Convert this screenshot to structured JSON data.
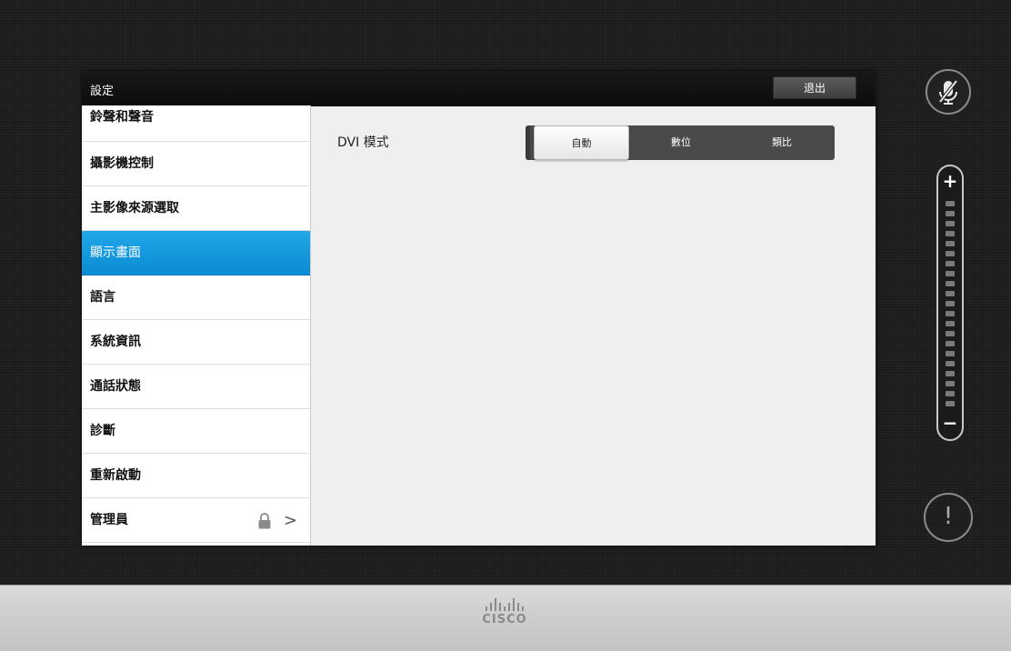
{
  "app": {
    "title": "設定",
    "exit_label": "退出"
  },
  "sidebar": {
    "items": [
      {
        "label": "鈴聲和聲音"
      },
      {
        "label": "攝影機控制"
      },
      {
        "label": "主影像來源選取"
      },
      {
        "label": "顯示畫面",
        "selected": true
      },
      {
        "label": "語言"
      },
      {
        "label": "系統資訊"
      },
      {
        "label": "通話狀態"
      },
      {
        "label": "診斷"
      },
      {
        "label": "重新啟動"
      },
      {
        "label": "管理員",
        "icons": [
          "lock-icon",
          "chevron-right-icon"
        ]
      }
    ]
  },
  "content": {
    "dvi_mode_label": "DVI 模式",
    "dvi_options": [
      {
        "label": "自動",
        "selected": true
      },
      {
        "label": "數位"
      },
      {
        "label": "類比"
      }
    ]
  },
  "controls": {
    "mute_icon": "mic-muted-icon",
    "volume_plus": "+",
    "volume_minus": "−",
    "alert_symbol": "!"
  },
  "footer": {
    "brand": "CISCO"
  },
  "colors": {
    "accent": "#0a8bd3",
    "panel_bg": "#efefef",
    "title_bg": "#111111"
  }
}
